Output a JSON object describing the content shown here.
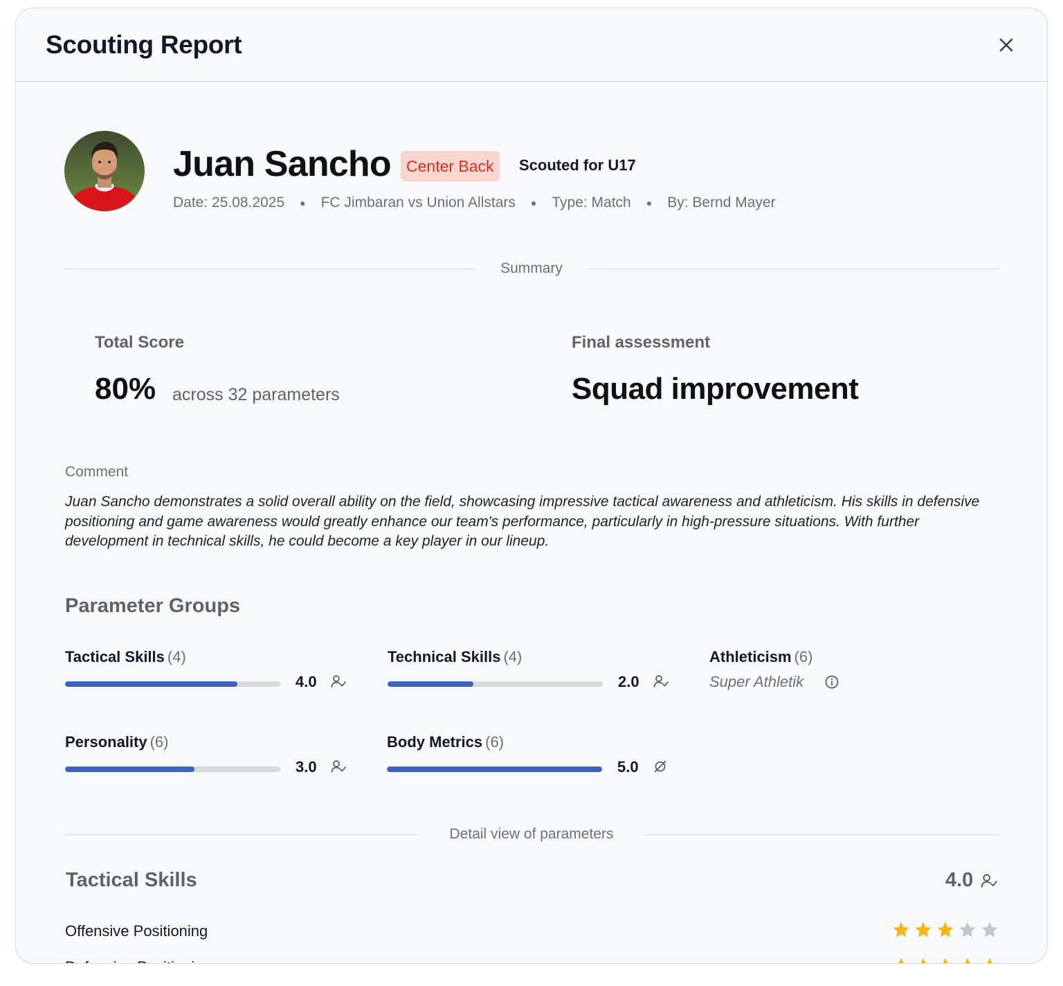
{
  "modal": {
    "title": "Scouting Report"
  },
  "player": {
    "name": "Juan Sancho",
    "position": "Center Back",
    "scouted_for": "Scouted for U17",
    "meta": {
      "date": "Date: 25.08.2025",
      "match": "FC Jimbaran vs Union Allstars",
      "type": "Type: Match",
      "by": "By: Bernd Mayer"
    }
  },
  "summary": {
    "section_label": "Summary",
    "total_score_label": "Total Score",
    "total_score_value": "80%",
    "total_score_sub": "across 32 parameters",
    "final_label": "Final assessment",
    "final_value": "Squad improvement"
  },
  "comment": {
    "label": "Comment",
    "text": "Juan Sancho demonstrates a solid overall ability on the field, showcasing impressive tactical awareness and athleticism. His skills in defensive positioning and game awareness would greatly enhance our team's performance, particularly in high-pressure situations. With further development in technical skills, he could become a key player in our lineup."
  },
  "parameter_groups": {
    "title": "Parameter Groups",
    "groups": [
      {
        "name": "Tactical Skills",
        "count": "(4)",
        "value": "4.0",
        "fill_fraction": 0.8,
        "icon": "person-check-icon"
      },
      {
        "name": "Technical Skills",
        "count": "(4)",
        "value": "2.0",
        "fill_fraction": 0.4,
        "icon": "person-check-icon"
      },
      {
        "name": "Athleticism",
        "count": "(6)",
        "note": "Super Athletik",
        "icon": "info-icon"
      },
      {
        "name": "Personality",
        "count": "(6)",
        "value": "3.0",
        "fill_fraction": 0.6,
        "icon": "person-check-icon"
      },
      {
        "name": "Body Metrics",
        "count": "(6)",
        "value": "5.0",
        "fill_fraction": 1.0,
        "icon": "empty-set-icon"
      }
    ]
  },
  "detail": {
    "section_label": "Detail view of parameters",
    "group_title": "Tactical Skills",
    "group_score": "4.0",
    "parameters": [
      {
        "name": "Offensive Positioning",
        "rating": 3,
        "max": 5
      },
      {
        "name": "Defensive Positioning",
        "rating": 5,
        "max": 5
      }
    ]
  },
  "colors": {
    "accent": "#3e63bd",
    "badge_bg": "#fbd5d0",
    "badge_text": "#d1331f",
    "star_filled": "#f5b70a",
    "star_empty": "#c4c6cb"
  }
}
